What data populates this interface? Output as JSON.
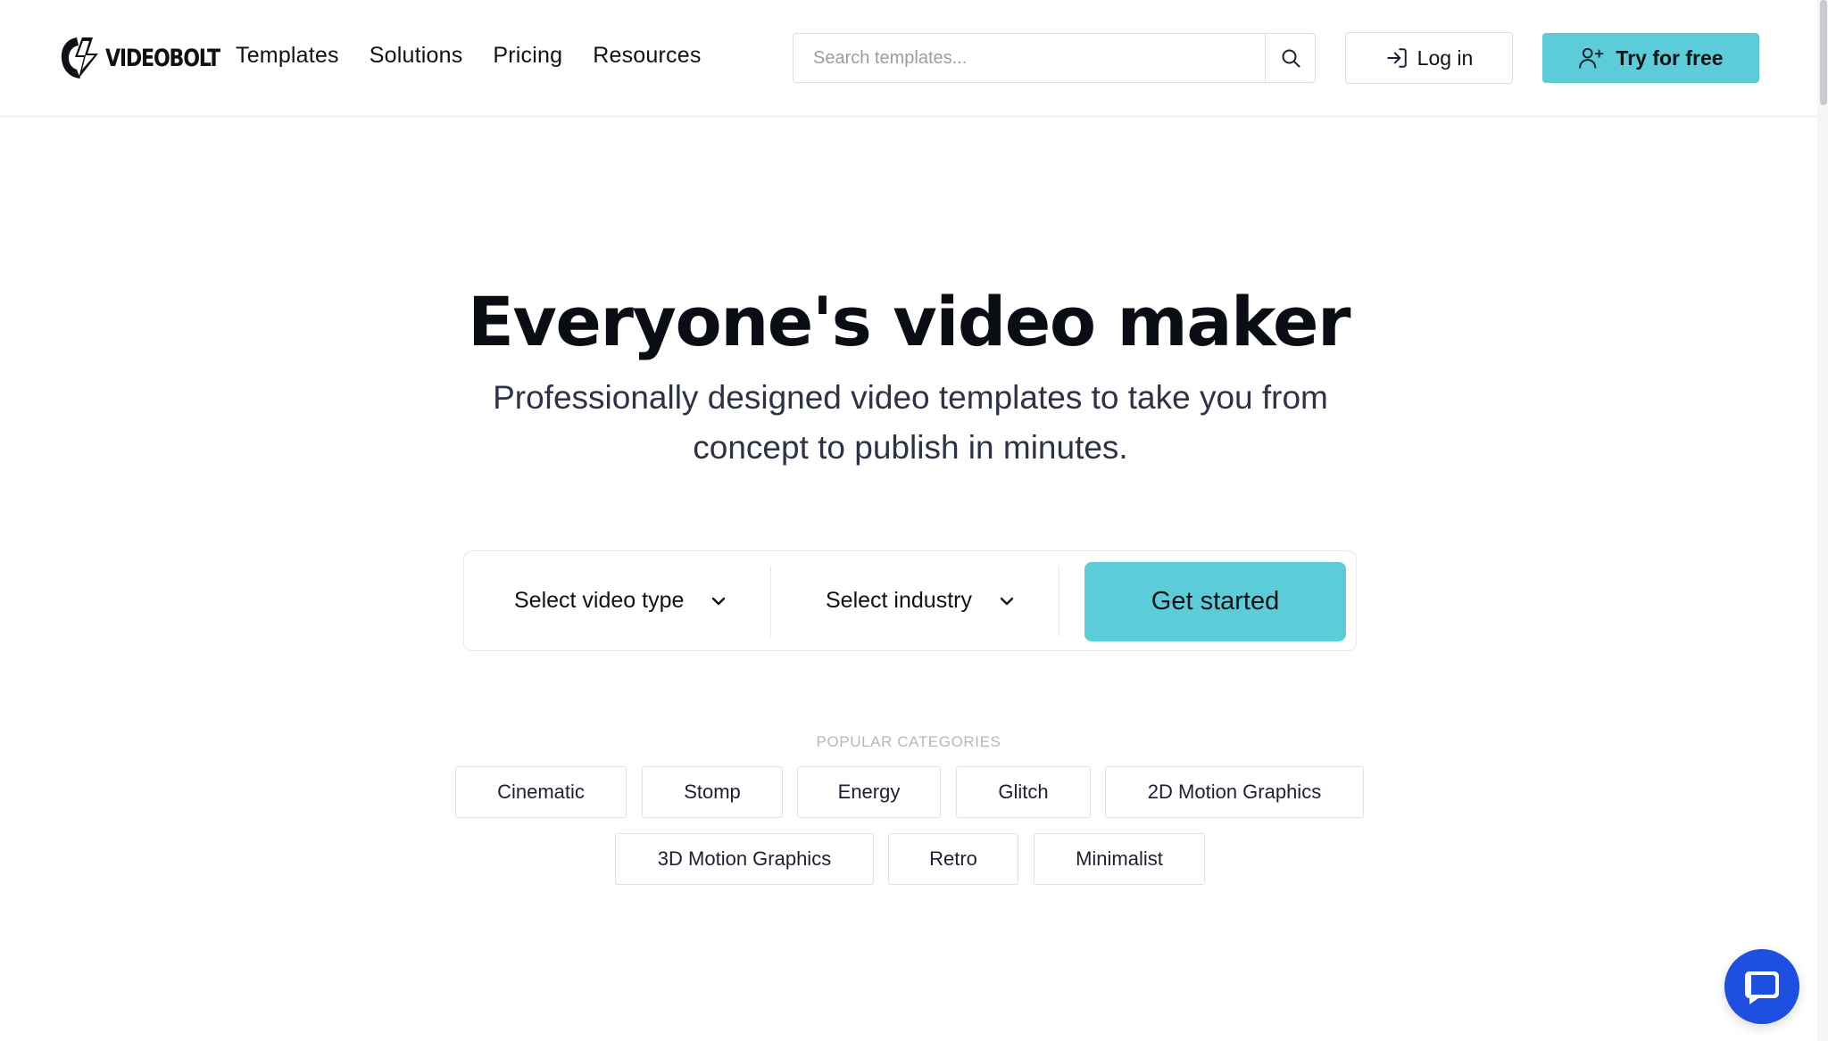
{
  "header": {
    "logo_text": "VIDEOBOLT",
    "nav": [
      {
        "label": "Templates"
      },
      {
        "label": "Solutions"
      },
      {
        "label": "Pricing"
      },
      {
        "label": "Resources"
      }
    ],
    "search": {
      "placeholder": "Search templates...",
      "value": ""
    },
    "login_label": "Log in",
    "try_label": "Try for free"
  },
  "hero": {
    "title": "Everyone's video maker",
    "subtitle": "Professionally designed video templates to take you from concept to publish in minutes."
  },
  "selector": {
    "video_type": "Select video type",
    "industry": "Select industry",
    "cta": "Get started"
  },
  "categories": {
    "heading": "POPULAR CATEGORIES",
    "items": [
      {
        "label": "Cinematic"
      },
      {
        "label": "Stomp"
      },
      {
        "label": "Energy"
      },
      {
        "label": "Glitch"
      },
      {
        "label": "2D Motion Graphics"
      },
      {
        "label": "3D Motion Graphics"
      },
      {
        "label": "Retro"
      },
      {
        "label": "Minimalist"
      }
    ]
  },
  "colors": {
    "accent": "#5ccdd8",
    "chat": "#1d4fe0",
    "text": "#0f1117"
  },
  "icons": {
    "search": "search-icon",
    "login": "login-icon",
    "signup": "user-plus-icon",
    "chevron": "chevron-down-icon",
    "chat": "chat-bubble-icon"
  }
}
